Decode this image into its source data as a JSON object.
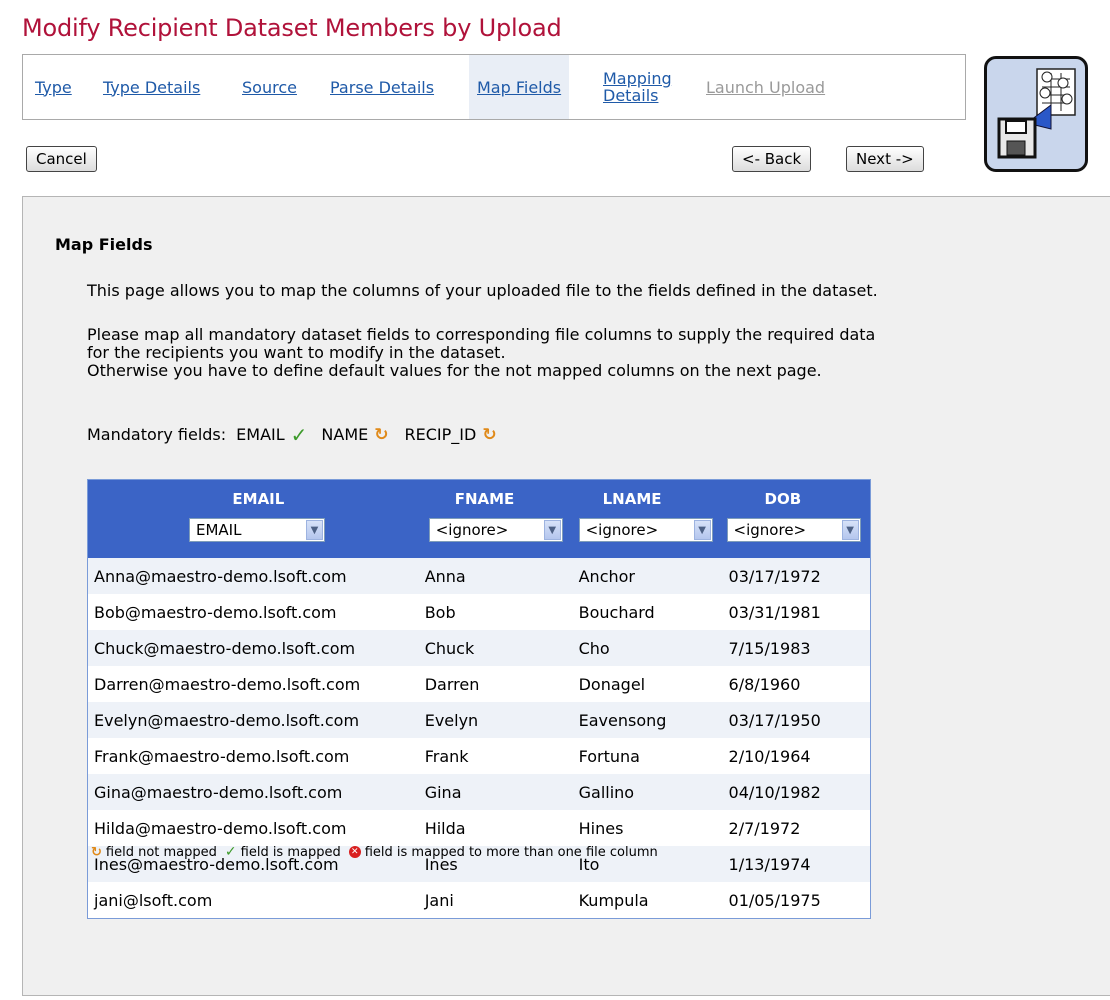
{
  "page_title": "Modify Recipient Dataset Members by Upload",
  "wizard": {
    "steps": [
      {
        "label": "Type",
        "state": "link"
      },
      {
        "label": "Type Details",
        "state": "link"
      },
      {
        "label": "Source",
        "state": "link"
      },
      {
        "label": "Parse Details",
        "state": "link"
      },
      {
        "label": "Map Fields",
        "state": "active"
      },
      {
        "label_line1": "Mapping",
        "label_line2": "Details",
        "state": "link"
      },
      {
        "label": "Launch Upload",
        "state": "disabled"
      }
    ],
    "icon": "dataset-upload-icon"
  },
  "buttons": {
    "cancel": "Cancel",
    "back": "<- Back",
    "next": "Next ->"
  },
  "section": {
    "title": "Map Fields",
    "intro": "This page allows you to map the columns of your uploaded file to the fields defined in the dataset.",
    "instruction_line1": "Please map all mandatory dataset fields to corresponding file columns to supply the required data",
    "instruction_line2": "for the recipients you want to modify in the dataset.",
    "instruction_line3": "Otherwise you have to define default values for the not mapped columns on the next page."
  },
  "mandatory": {
    "label": "Mandatory fields:",
    "fields": [
      {
        "name": "EMAIL",
        "status": "mapped",
        "icon": "check-icon"
      },
      {
        "name": "NAME",
        "status": "not-mapped",
        "icon": "not-mapped-icon"
      },
      {
        "name": "RECIP_ID",
        "status": "not-mapped",
        "icon": "not-mapped-icon"
      }
    ]
  },
  "table": {
    "columns": [
      {
        "header": "EMAIL",
        "selected": "EMAIL"
      },
      {
        "header": "FNAME",
        "selected": "<ignore>"
      },
      {
        "header": "LNAME",
        "selected": "<ignore>"
      },
      {
        "header": "DOB",
        "selected": "<ignore>"
      }
    ],
    "rows": [
      [
        "Anna@maestro-demo.lsoft.com",
        "Anna",
        "Anchor",
        "03/17/1972"
      ],
      [
        "Bob@maestro-demo.lsoft.com",
        "Bob",
        "Bouchard",
        "03/31/1981"
      ],
      [
        "Chuck@maestro-demo.lsoft.com",
        "Chuck",
        "Cho",
        "7/15/1983"
      ],
      [
        "Darren@maestro-demo.lsoft.com",
        "Darren",
        "Donagel",
        "6/8/1960"
      ],
      [
        "Evelyn@maestro-demo.lsoft.com",
        "Evelyn",
        "Eavensong",
        "03/17/1950"
      ],
      [
        "Frank@maestro-demo.lsoft.com",
        "Frank",
        "Fortuna",
        "2/10/1964"
      ],
      [
        "Gina@maestro-demo.lsoft.com",
        "Gina",
        "Gallino",
        "04/10/1982"
      ],
      [
        "Hilda@maestro-demo.lsoft.com",
        "Hilda",
        "Hines",
        "2/7/1972"
      ],
      [
        "Ines@maestro-demo.lsoft.com",
        "Ines",
        "Ito",
        "1/13/1974"
      ],
      [
        "jani@lsoft.com",
        "Jani",
        "Kumpula",
        "01/05/1975"
      ]
    ]
  },
  "legend": {
    "not_mapped": "field not mapped",
    "mapped": "field is mapped",
    "multi_mapped": "field is mapped to more than one file column"
  },
  "colors": {
    "title": "#b0123a",
    "link": "#1f5aa8",
    "table_header": "#3b64c6",
    "mapped": "#3c9a2a",
    "not_mapped": "#e08a1a",
    "error": "#d92020"
  }
}
